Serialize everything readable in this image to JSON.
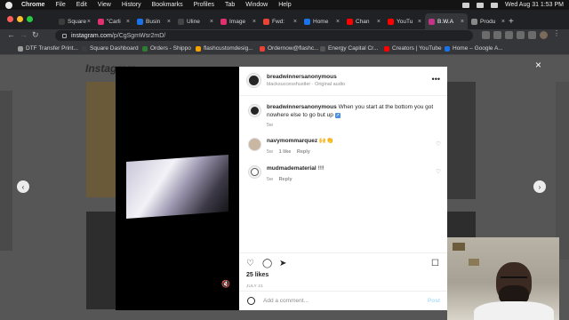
{
  "menubar": {
    "app": "Chrome",
    "items": [
      "File",
      "Edit",
      "View",
      "History",
      "Bookmarks",
      "Profiles",
      "Tab",
      "Window",
      "Help"
    ],
    "clock": "Wed Aug 31  1:53 PM"
  },
  "tabs": [
    {
      "label": "Square",
      "color": "#3c3c3c"
    },
    {
      "label": "\"Carli",
      "color": "#e1306c"
    },
    {
      "label": "Busin",
      "color": "#1a73e8"
    },
    {
      "label": "Uline",
      "color": "#444444"
    },
    {
      "label": "Image",
      "color": "#e1306c"
    },
    {
      "label": "Fwd:",
      "color": "#ea4335"
    },
    {
      "label": "Home",
      "color": "#1a73e8"
    },
    {
      "label": "Chan",
      "color": "#ff0000"
    },
    {
      "label": "YouTu",
      "color": "#ff0000"
    },
    {
      "label": "B.W.A",
      "color": "#c13584"
    },
    {
      "label": "Produ",
      "color": "#888888"
    }
  ],
  "address": {
    "host": "instagram.com",
    "path": "/p/CgSgmWsr2mD/"
  },
  "bookmarks": [
    {
      "label": "DTF Transfer Print...",
      "color": "#9c9c9c"
    },
    {
      "label": "Square Dashboard",
      "color": "#3c3c3c"
    },
    {
      "label": "Orders - Shippo",
      "color": "#2e7d32"
    },
    {
      "label": "flashcustomdesig...",
      "color": "#f4a300"
    },
    {
      "label": "Ordernow@flashc...",
      "color": "#ea4335"
    },
    {
      "label": "Energy Capital Cr...",
      "color": "#555555"
    },
    {
      "label": "Creators | YouTube",
      "color": "#ff0000"
    },
    {
      "label": "Home – Google A...",
      "color": "#1a73e8"
    }
  ],
  "background": {
    "logo": "Instagram"
  },
  "post": {
    "author": "breadwinnersanonymous",
    "subtitle": "blacksuccesshustler · Original audio",
    "caption": "When you start at the bottom you got nowhere else to go but up",
    "caption_emoji": "↗",
    "caption_time": "5w",
    "comments": [
      {
        "user": "navymommarquez",
        "text": "🙌👏",
        "time": "5w",
        "likes": "1 like",
        "reply": "Reply"
      },
      {
        "user": "mudmadematerial",
        "text": "!!!!",
        "time": "5w",
        "likes": "",
        "reply": "Reply"
      }
    ],
    "likes": "25 likes",
    "date": "JULY 21",
    "add_comment_placeholder": "Add a comment...",
    "post_label": "Post"
  },
  "icons": {
    "close": "×",
    "prev": "‹",
    "next": "›",
    "more": "•••",
    "heart": "♡",
    "comment": "◯",
    "share": "➤",
    "save": "☐",
    "mute": "🔇"
  },
  "colors": {
    "instagram_blue_disabled": "#b2dffc",
    "overlay": "#565656"
  }
}
